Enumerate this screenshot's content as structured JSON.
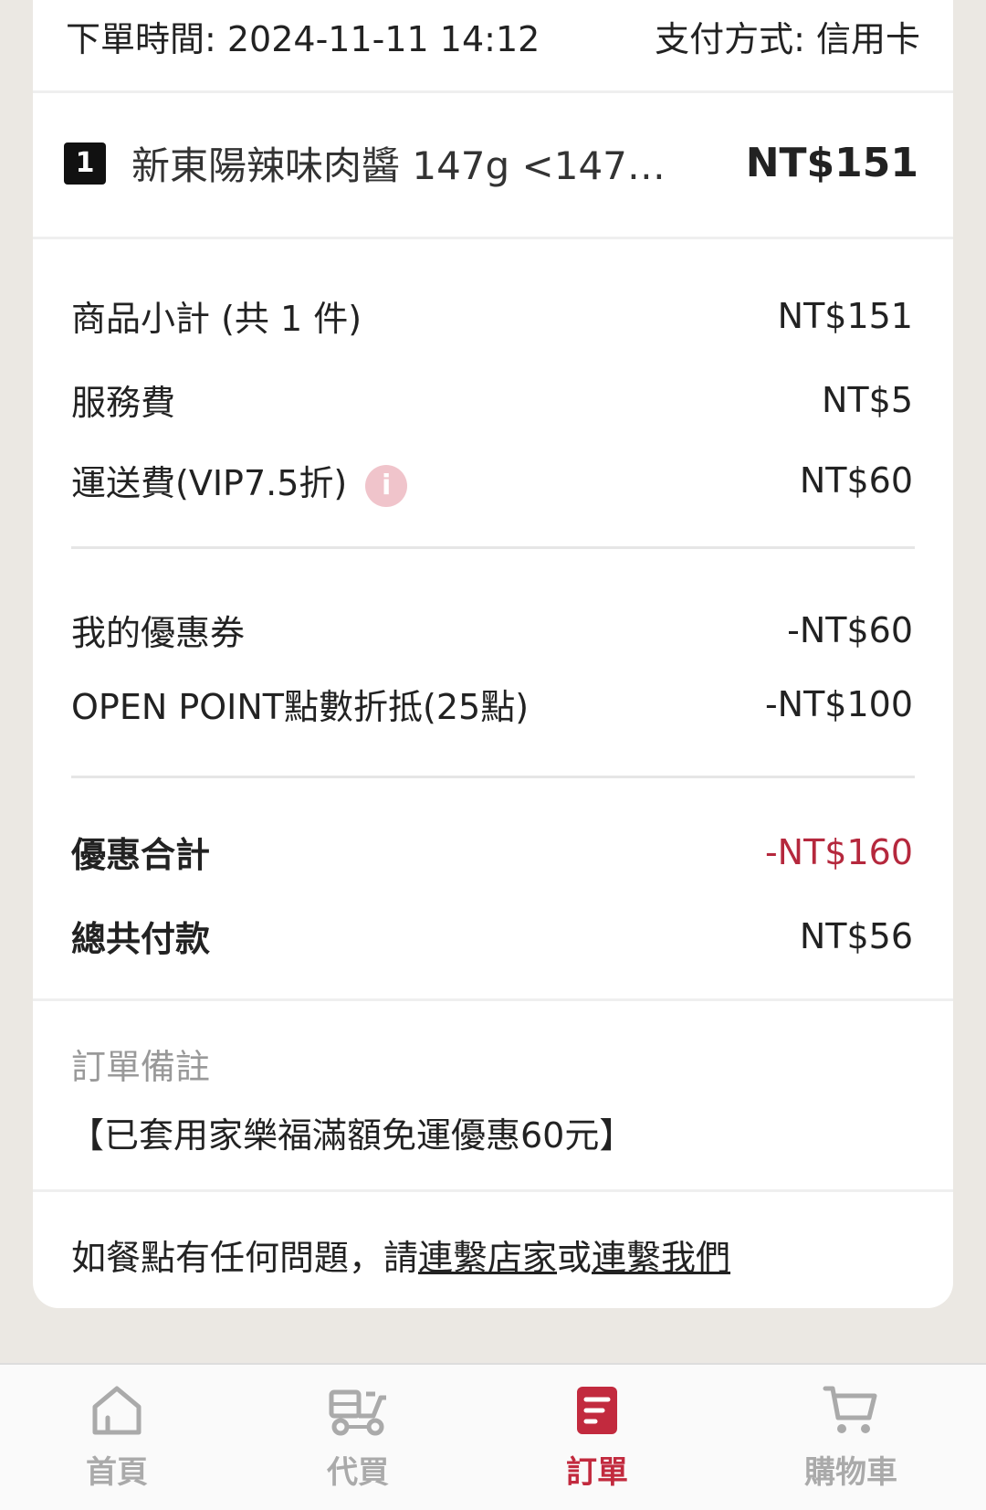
{
  "order": {
    "time_label": "下單時間: 2024-11-11 14:12",
    "payment_label": "支付方式: 信用卡"
  },
  "item": {
    "qty": "1",
    "name": "新東陽辣味肉醬 147g <147g...",
    "price": "NT$151"
  },
  "summary": {
    "subtotal_label": "商品小計 (共 1 件)",
    "subtotal_value": "NT$151",
    "service_label": "服務費",
    "service_value": "NT$5",
    "shipping_label": "運送費(VIP7.5折)",
    "shipping_value": "NT$60",
    "coupon_label": "我的優惠券",
    "coupon_value": "-NT$60",
    "points_label": "OPEN POINT點數折抵(25點)",
    "points_value": "-NT$100",
    "discount_total_label": "優惠合計",
    "discount_total_value": "-NT$160",
    "grand_total_label": "總共付款",
    "grand_total_value": "NT$56"
  },
  "note": {
    "title": "訂單備註",
    "text": "【已套用家樂福滿額免運優惠60元】"
  },
  "help": {
    "prefix": "如餐點有任何問題，請",
    "link_store": "連繫店家",
    "middle": "或",
    "link_us": "連繫我們"
  },
  "tabs": [
    {
      "label": "首頁",
      "icon": "home-icon"
    },
    {
      "label": "代買",
      "icon": "delivery-scooter-icon"
    },
    {
      "label": "訂單",
      "icon": "order-icon",
      "active": true
    },
    {
      "label": "購物車",
      "icon": "cart-icon"
    }
  ],
  "colors": {
    "accent": "#c22a3e",
    "background": "#ebe8e3",
    "info_icon": "#f0c4cb"
  }
}
